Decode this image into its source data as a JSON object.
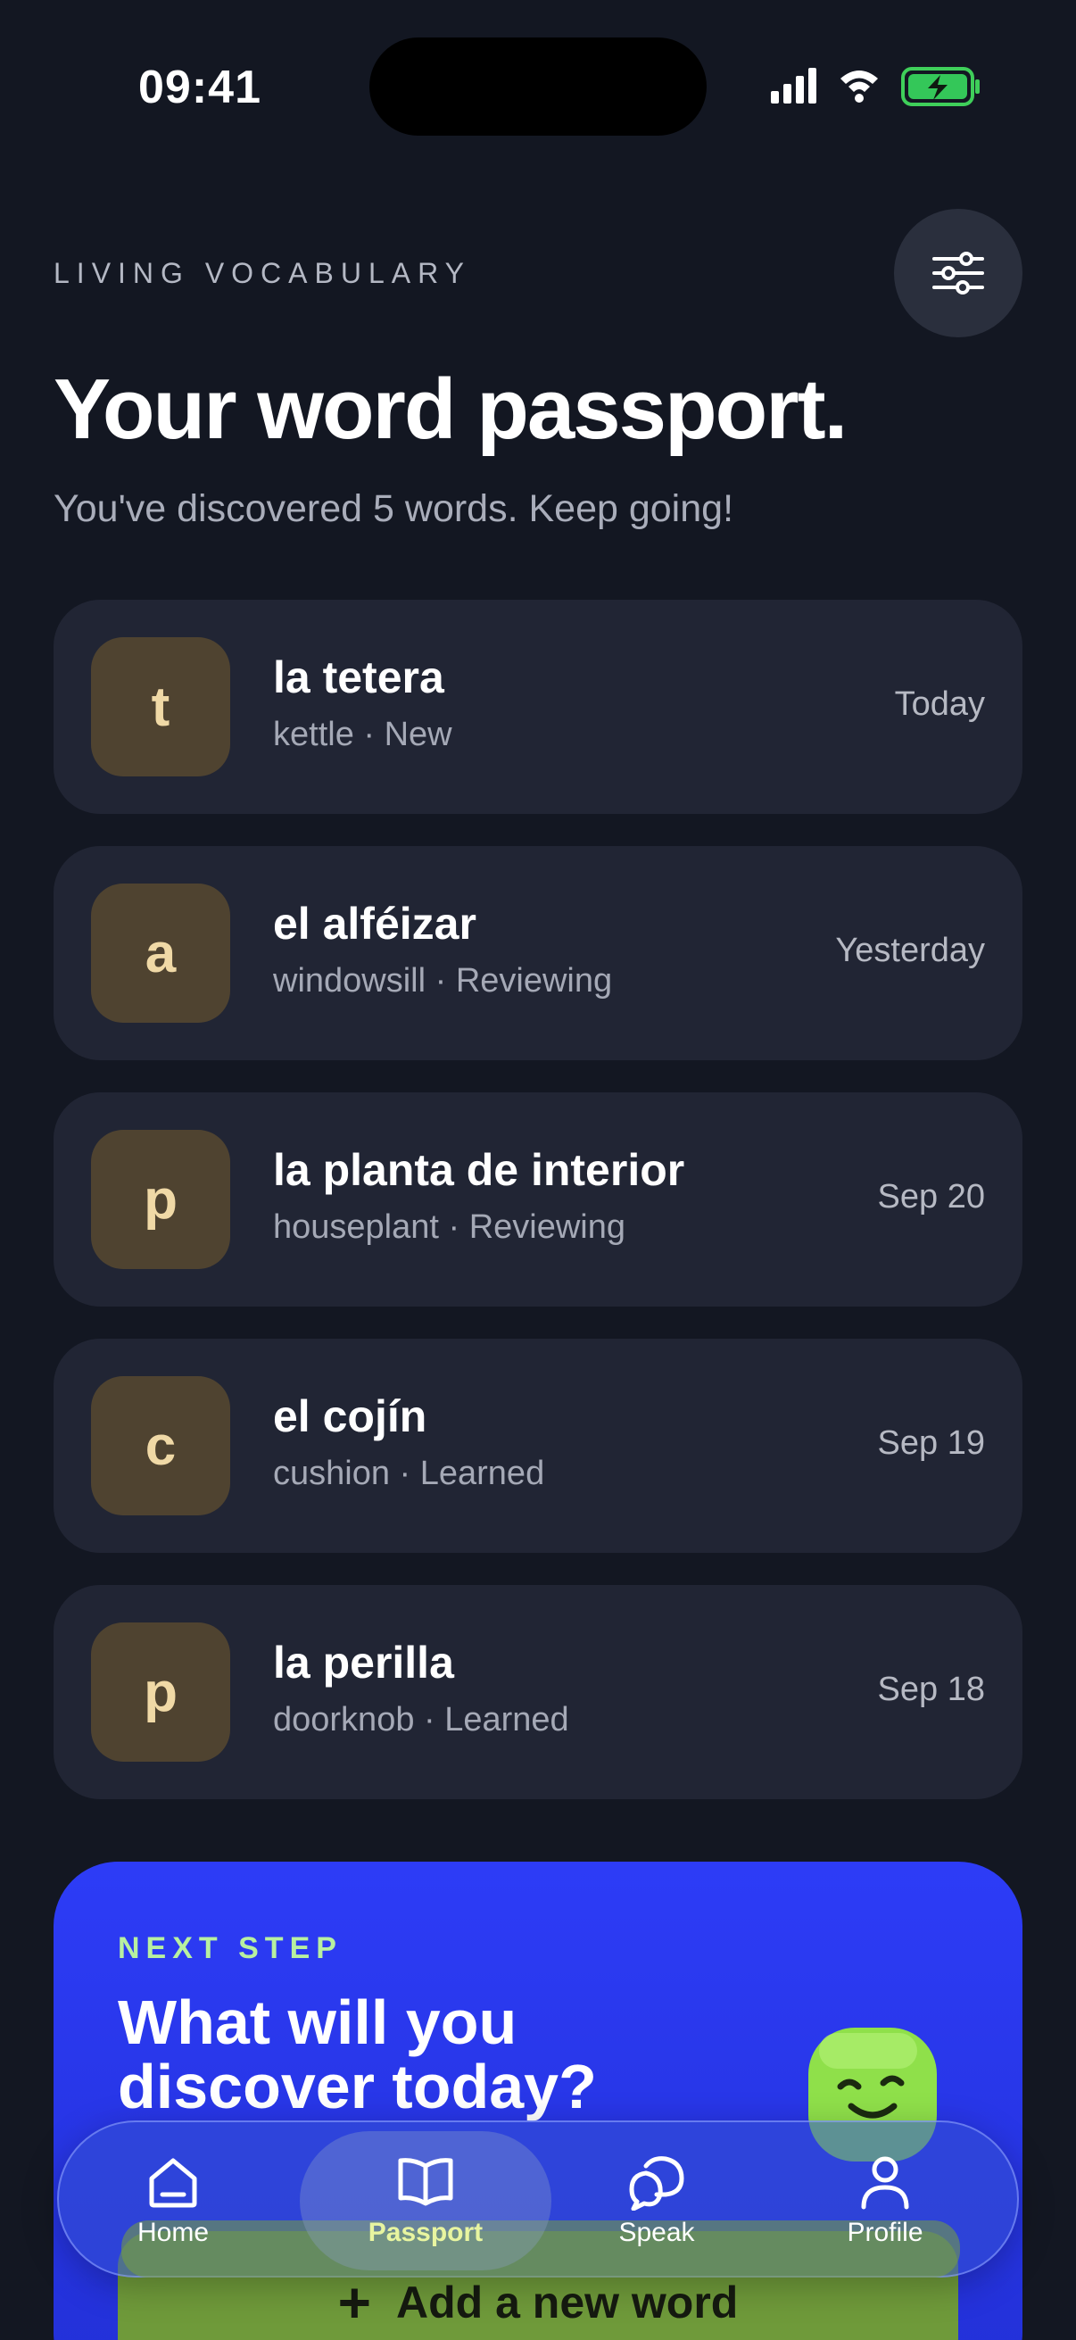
{
  "status_bar": {
    "time": "09:41"
  },
  "header": {
    "eyebrow": "LIVING VOCABULARY",
    "title": "Your word passport.",
    "subtitle": "You've discovered 5 words. Keep going!"
  },
  "words": [
    {
      "initial": "t",
      "word": "la tetera",
      "meta": "kettle · New",
      "date": "Today"
    },
    {
      "initial": "a",
      "word": "el alféizar",
      "meta": "windowsill · Reviewing",
      "date": "Yesterday"
    },
    {
      "initial": "p",
      "word": "la planta de interior",
      "meta": "houseplant · Reviewing",
      "date": "Sep 20"
    },
    {
      "initial": "c",
      "word": "el cojín",
      "meta": "cushion · Learned",
      "date": "Sep 19"
    },
    {
      "initial": "p",
      "word": "la perilla",
      "meta": "doorknob · Learned",
      "date": "Sep 18"
    }
  ],
  "next_step": {
    "eyebrow": "NEXT STEP",
    "title": "What will you discover today?",
    "button_label": "Add a new word"
  },
  "tabs": [
    {
      "label": "Home",
      "icon": "home-icon",
      "active": false
    },
    {
      "label": "Passport",
      "icon": "book-icon",
      "active": true
    },
    {
      "label": "Speak",
      "icon": "chat-icon",
      "active": false
    },
    {
      "label": "Profile",
      "icon": "person-icon",
      "active": false
    }
  ],
  "colors": {
    "background": "#131722",
    "card": "#212534",
    "tile": "#4f4330",
    "accent_blue": "#2d3cf7",
    "accent_green": "#b8f0a0",
    "button_green": "#6f9a3a"
  }
}
